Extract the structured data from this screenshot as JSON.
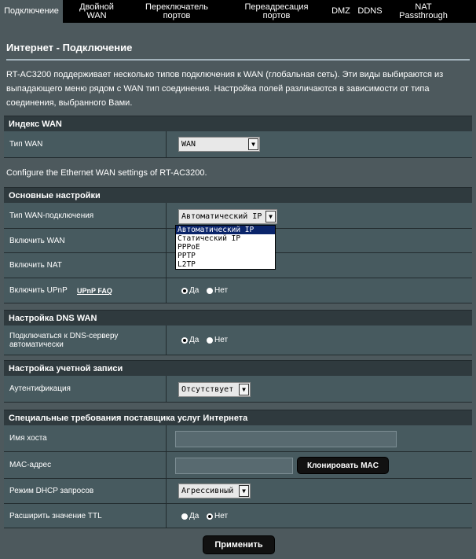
{
  "tabs": [
    {
      "label": "Подключение"
    },
    {
      "label": "Двойной WAN"
    },
    {
      "label": "Переключатель портов"
    },
    {
      "label": "Переадресация портов"
    },
    {
      "label": "DMZ"
    },
    {
      "label": "DDNS"
    },
    {
      "label": "NAT Passthrough"
    }
  ],
  "page": {
    "title": "Интернет - Подключение",
    "description": "RT-AC3200 поддерживает несколько типов подключения к WAN (глобальная сеть). Эти виды выбираются из выпадающего меню рядом с WAN тип соединения. Настройка полей различаются в зависимости от типа соединения, выбранного Вами.",
    "configure_text": "Configure the Ethernet WAN settings of RT-AC3200."
  },
  "wan_index": {
    "header": "Индекс WAN",
    "type_label": "Тип WAN",
    "type_value": "WAN"
  },
  "basic": {
    "header": "Основные настройки",
    "conn_type_label": "Тип WAN-подключения",
    "conn_type_value": "Автоматический IP",
    "conn_type_options": [
      "Автоматический IP",
      "Статический IP",
      "PPPoE",
      "PPTP",
      "L2TP"
    ],
    "enable_wan_label": "Включить WAN",
    "enable_nat_label": "Включить NAT",
    "enable_upnp_label": "Включить UPnP",
    "upnp_faq": "UPnP FAQ",
    "yes": "Да",
    "no": "Нет"
  },
  "dns": {
    "header": "Настройка DNS WAN",
    "auto_label": "Подключаться к DNS-серверу автоматически",
    "yes": "Да",
    "no": "Нет"
  },
  "account": {
    "header": "Настройка учетной записи",
    "auth_label": "Аутентификация",
    "auth_value": "Отсутствует"
  },
  "isp": {
    "header": "Специальные требования поставщика услуг Интернета",
    "hostname_label": "Имя хоста",
    "hostname_value": "",
    "mac_label": "MAC-адрес",
    "mac_value": "",
    "clone_mac": "Клонировать MAC",
    "dhcp_label": "Режим DHCP запросов",
    "dhcp_value": "Агрессивный",
    "ttl_label": "Расширить значение TTL",
    "yes": "Да",
    "no": "Нет"
  },
  "apply": "Применить",
  "colors": {
    "background": "#4d595d",
    "section_header": "#2f3a3e",
    "tab_bar": "#000000",
    "dropdown_selected": "#0a246a"
  }
}
